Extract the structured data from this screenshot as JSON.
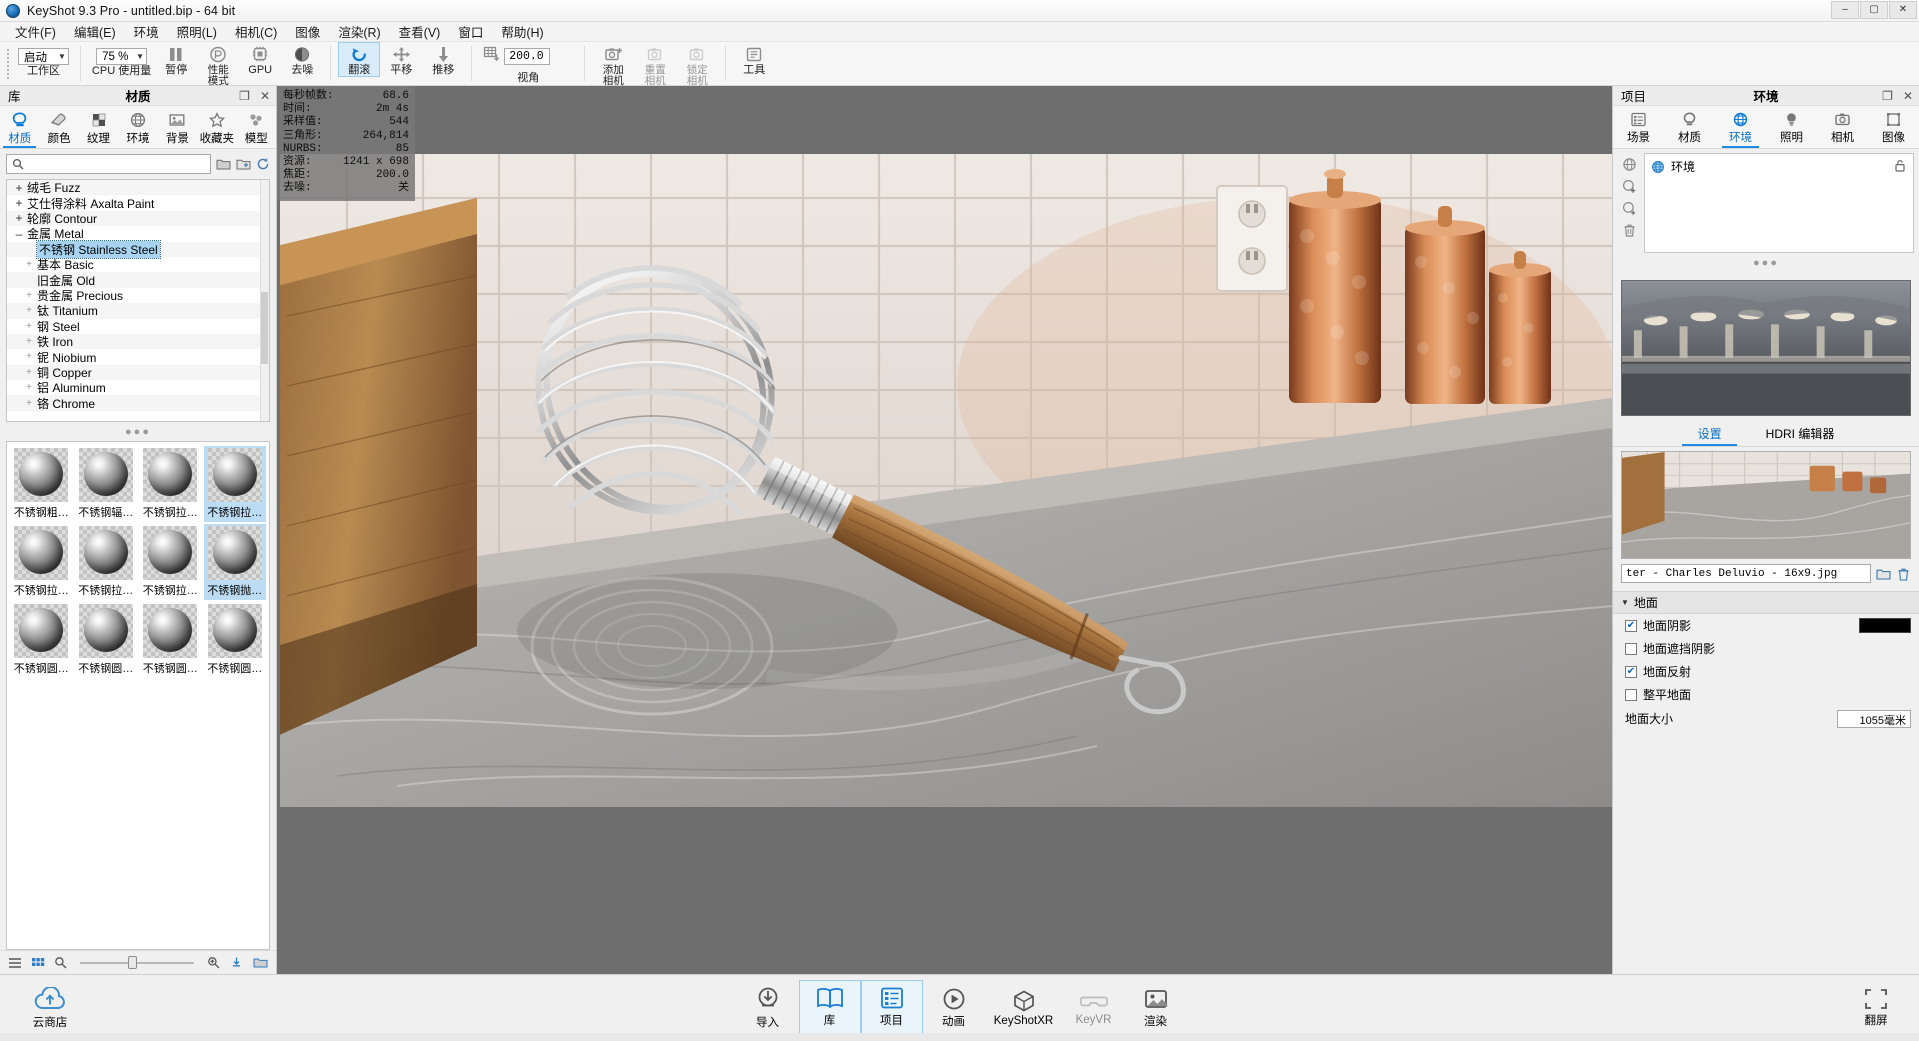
{
  "window": {
    "app_name": "KeyShot 9.3 Pro",
    "document": "untitled.bip",
    "arch": "64 bit",
    "title_full": "KeyShot 9.3 Pro  - untitled.bip  - 64 bit",
    "minimize": "–",
    "maximize": "▢",
    "close": "✕"
  },
  "menu": [
    {
      "label": "文件(F)"
    },
    {
      "label": "编辑(E)"
    },
    {
      "label": "环境"
    },
    {
      "label": "照明(L)"
    },
    {
      "label": "相机(C)"
    },
    {
      "label": "图像"
    },
    {
      "label": "渲染(R)"
    },
    {
      "label": "查看(V)"
    },
    {
      "label": "窗口"
    },
    {
      "label": "帮助(H)"
    }
  ],
  "toolbar": {
    "workspace_value": "启动",
    "workspace_label": "工作区",
    "cpu_value": "75 %",
    "cpu_label": "CPU 使用量",
    "pause_label": "暂停",
    "perf_label_1": "性能",
    "perf_label_2": "模式",
    "gpu_label": "GPU",
    "denoise_label": "去噪",
    "tumble_label": "翻滚",
    "pan_label": "平移",
    "dolly_label": "推移",
    "fov_value": "200.0",
    "view_label": "视角",
    "add_camera_label_1": "添加",
    "add_camera_label_2": "相机",
    "reset_camera_label_1": "重置",
    "reset_camera_label_2": "相机",
    "lock_camera_label_1": "锁定",
    "lock_camera_label_2": "相机",
    "tools_label": "工具"
  },
  "library": {
    "header_left": "库",
    "header_title": "材质",
    "tabs": [
      {
        "label": "材质",
        "icon": "material-icon",
        "selected": true
      },
      {
        "label": "颜色",
        "icon": "color-icon",
        "selected": false
      },
      {
        "label": "纹理",
        "icon": "texture-icon",
        "selected": false
      },
      {
        "label": "环境",
        "icon": "environment-icon",
        "selected": false
      },
      {
        "label": "背景",
        "icon": "backplate-icon",
        "selected": false
      },
      {
        "label": "收藏夹",
        "icon": "star-icon",
        "selected": false
      },
      {
        "label": "模型",
        "icon": "model-icon",
        "selected": false
      }
    ],
    "search_placeholder": "",
    "search_value": "",
    "tree": [
      {
        "label": "绒毛 Fuzz",
        "expander": "+",
        "level": 0,
        "selected": false
      },
      {
        "label": "艾仕得涂料 Axalta Paint",
        "expander": "+",
        "level": 0,
        "selected": false
      },
      {
        "label": "轮廓 Contour",
        "expander": "+",
        "level": 0,
        "selected": false
      },
      {
        "label": "金属 Metal",
        "expander": "–",
        "level": 0,
        "selected": false
      },
      {
        "label": "不锈钢 Stainless Steel",
        "expander": "",
        "level": 1,
        "selected": true
      },
      {
        "label": "基本 Basic",
        "expander": "+",
        "level": 1,
        "selected": false
      },
      {
        "label": "旧金属 Old",
        "expander": "",
        "level": 1,
        "selected": false
      },
      {
        "label": "贵金属 Precious",
        "expander": "+",
        "level": 1,
        "selected": false
      },
      {
        "label": "钛 Titanium",
        "expander": "+",
        "level": 1,
        "selected": false
      },
      {
        "label": "钢 Steel",
        "expander": "+",
        "level": 1,
        "selected": false
      },
      {
        "label": "铁 Iron",
        "expander": "+",
        "level": 1,
        "selected": false
      },
      {
        "label": "铌 Niobium",
        "expander": "+",
        "level": 1,
        "selected": false
      },
      {
        "label": "铜 Copper",
        "expander": "+",
        "level": 1,
        "selected": false
      },
      {
        "label": "铝 Aluminum",
        "expander": "+",
        "level": 1,
        "selected": false
      },
      {
        "label": "铬 Chrome",
        "expander": "+",
        "level": 1,
        "selected": false
      }
    ],
    "thumbnails": [
      {
        "label": "不锈钢粗…",
        "selected": false
      },
      {
        "label": "不锈钢辐…",
        "selected": false
      },
      {
        "label": "不锈钢拉…",
        "selected": false
      },
      {
        "label": "不锈钢拉…",
        "selected": true
      },
      {
        "label": "不锈钢拉…",
        "selected": false
      },
      {
        "label": "不锈钢拉…",
        "selected": false
      },
      {
        "label": "不锈钢拉…",
        "selected": false
      },
      {
        "label": "不锈钢抛…",
        "selected": true
      },
      {
        "label": "不锈钢圆…",
        "selected": false
      },
      {
        "label": "不锈钢圆…",
        "selected": false
      },
      {
        "label": "不锈钢圆…",
        "selected": false
      },
      {
        "label": "不锈钢圆…",
        "selected": false
      }
    ],
    "footer_icons": [
      "list-view-icon",
      "grid-view-icon",
      "search-icon",
      "zoom-out-icon",
      "zoom-in-icon",
      "download-icon",
      "folder-icon"
    ]
  },
  "stats": {
    "rows": [
      {
        "key": "每秒帧数:",
        "value": "68.6"
      },
      {
        "key": "时间:",
        "value": "2m 4s"
      },
      {
        "key": "采样值:",
        "value": "544"
      },
      {
        "key": "三角形:",
        "value": "264,814"
      },
      {
        "key": "NURBS:",
        "value": "85"
      },
      {
        "key": "资源:",
        "value": "1241 x 698"
      },
      {
        "key": "焦距:",
        "value": "200.0"
      },
      {
        "key": "去噪:",
        "value": "关"
      }
    ]
  },
  "project": {
    "header_left": "项目",
    "header_title": "环境",
    "tabs": [
      {
        "label": "场景",
        "icon": "scene-icon",
        "selected": false
      },
      {
        "label": "材质",
        "icon": "material-icon",
        "selected": false
      },
      {
        "label": "环境",
        "icon": "environment-icon",
        "selected": true
      },
      {
        "label": "照明",
        "icon": "lighting-icon",
        "selected": false
      },
      {
        "label": "相机",
        "icon": "camera-icon",
        "selected": false
      },
      {
        "label": "图像",
        "icon": "image-icon",
        "selected": false
      }
    ],
    "env_list_item": "环境",
    "side_tools": [
      "environment-globe-icon",
      "add-environment-icon",
      "duplicate-environment-icon",
      "delete-icon"
    ],
    "section_tabs": [
      {
        "label": "设置",
        "selected": true
      },
      {
        "label": "HDRI 编辑器",
        "selected": false
      }
    ],
    "hdri_filename": "ter - Charles Deluvio - 16x9.jpg",
    "ground": {
      "title": "地面",
      "shadow_label": "地面阴影",
      "shadow_checked": true,
      "shadow_color": "#000000",
      "occlusion_label": "地面遮挡阴影",
      "occlusion_checked": false,
      "reflection_label": "地面反射",
      "reflection_checked": true,
      "flatten_label": "整平地面",
      "flatten_checked": false,
      "size_label": "地面大小",
      "size_value": "1055毫米"
    }
  },
  "bottom_dock": {
    "cloud_label": "云商店",
    "buttons": [
      {
        "label": "导入",
        "icon": "import-icon",
        "active": false,
        "dim": false
      },
      {
        "label": "库",
        "icon": "library-book-icon",
        "active": true,
        "dim": false
      },
      {
        "label": "项目",
        "icon": "project-icon",
        "active": true,
        "dim": false
      },
      {
        "label": "动画",
        "icon": "animation-play-icon",
        "active": false,
        "dim": false
      },
      {
        "label": "KeyShotXR",
        "icon": "keyshotxr-icon",
        "active": false,
        "dim": false
      },
      {
        "label": "KeyVR",
        "icon": "keyvr-icon",
        "active": false,
        "dim": true
      },
      {
        "label": "渲染",
        "icon": "render-icon",
        "active": false,
        "dim": false
      }
    ],
    "fullscreen_label": "翻屏"
  },
  "colors": {
    "accent": "#1f8ae0",
    "selection": "#a8d3f0",
    "viewport_bg": "#6e6e6e",
    "panel_bg": "#f0f0f0"
  }
}
